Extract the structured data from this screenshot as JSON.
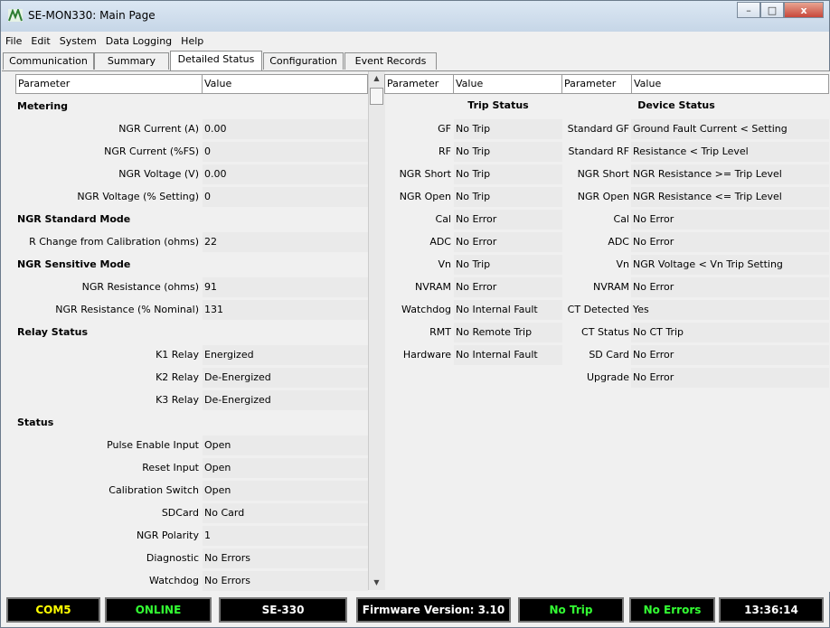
{
  "window": {
    "title": "SE-MON330: Main Page",
    "controls": {
      "minimize": "–",
      "maximize": "□",
      "close": "x"
    }
  },
  "menu": [
    "File",
    "Edit",
    "System",
    "Data Logging",
    "Help"
  ],
  "tabs": [
    "Communication",
    "Summary",
    "Detailed Status",
    "Configuration",
    "Event Records"
  ],
  "active_tab": "Detailed Status",
  "left_table": {
    "headers": [
      "Parameter",
      "Value"
    ],
    "sections": [
      {
        "title": "Metering",
        "rows": [
          {
            "param": "NGR Current (A)",
            "value": "0.00"
          },
          {
            "param": "NGR Current (%FS)",
            "value": "0"
          },
          {
            "param": "NGR Voltage (V)",
            "value": "0.00"
          },
          {
            "param": "NGR Voltage (% Setting)",
            "value": "0"
          }
        ]
      },
      {
        "title": "NGR Standard Mode",
        "rows": [
          {
            "param": "R Change from Calibration (ohms)",
            "value": "22"
          }
        ]
      },
      {
        "title": "NGR Sensitive Mode",
        "rows": [
          {
            "param": "NGR Resistance (ohms)",
            "value": "91"
          },
          {
            "param": "NGR Resistance (% Nominal)",
            "value": "131"
          }
        ]
      },
      {
        "title": "Relay Status",
        "rows": [
          {
            "param": "K1 Relay",
            "value": "Energized"
          },
          {
            "param": "K2 Relay",
            "value": "De-Energized"
          },
          {
            "param": "K3 Relay",
            "value": "De-Energized"
          }
        ]
      },
      {
        "title": "Status",
        "rows": [
          {
            "param": "Pulse Enable Input",
            "value": "Open"
          },
          {
            "param": "Reset Input",
            "value": "Open"
          },
          {
            "param": "Calibration Switch",
            "value": "Open"
          },
          {
            "param": "SDCard",
            "value": "No Card"
          },
          {
            "param": "NGR Polarity",
            "value": "1"
          },
          {
            "param": "Diagnostic",
            "value": "No Errors"
          },
          {
            "param": "Watchdog",
            "value": "No Errors"
          }
        ]
      }
    ]
  },
  "trip_table": {
    "headers": [
      "Parameter",
      "Value"
    ],
    "title": "Trip Status",
    "rows": [
      {
        "param": "GF",
        "value": "No Trip"
      },
      {
        "param": "RF",
        "value": "No Trip"
      },
      {
        "param": "NGR Short",
        "value": "No Trip"
      },
      {
        "param": "NGR Open",
        "value": "No Trip"
      },
      {
        "param": "Cal",
        "value": "No Error"
      },
      {
        "param": "ADC",
        "value": "No Error"
      },
      {
        "param": "Vn",
        "value": "No Trip"
      },
      {
        "param": "NVRAM",
        "value": "No Error"
      },
      {
        "param": "Watchdog",
        "value": "No Internal Fault"
      },
      {
        "param": "RMT",
        "value": "No Remote Trip"
      },
      {
        "param": "Hardware",
        "value": "No Internal Fault"
      }
    ]
  },
  "device_table": {
    "headers": [
      "Parameter",
      "Value"
    ],
    "title": "Device Status",
    "rows": [
      {
        "param": "Standard GF",
        "value": "Ground Fault Current < Setting"
      },
      {
        "param": "Standard RF",
        "value": "Resistance < Trip Level"
      },
      {
        "param": "NGR Short",
        "value": "NGR Resistance >= Trip Level"
      },
      {
        "param": "NGR Open",
        "value": "NGR Resistance <= Trip Level"
      },
      {
        "param": "Cal",
        "value": "No Error"
      },
      {
        "param": "ADC",
        "value": "No Error"
      },
      {
        "param": "Vn",
        "value": "NGR Voltage < Vn Trip Setting"
      },
      {
        "param": "NVRAM",
        "value": "No Error"
      },
      {
        "param": "CT Detected",
        "value": "Yes"
      },
      {
        "param": "CT Status",
        "value": "No CT Trip"
      },
      {
        "param": "SD Card",
        "value": "No Error"
      },
      {
        "param": "Upgrade",
        "value": "No Error"
      }
    ]
  },
  "status_bar": [
    {
      "text": "COM5",
      "color": "#ffff00"
    },
    {
      "text": "ONLINE",
      "color": "#33ff33"
    },
    {
      "text": "SE-330",
      "color": "#ffffff"
    },
    {
      "text": "Firmware Version: 3.10",
      "color": "#ffffff"
    },
    {
      "text": "No Trip",
      "color": "#33ff33"
    },
    {
      "text": "No Errors",
      "color": "#33ff33"
    },
    {
      "text": "13:36:14",
      "color": "#ffffff"
    }
  ],
  "colors": {
    "title_icon": "#3a8a3a",
    "value_cell": "#eaeaea",
    "status_bg": "#000000"
  }
}
